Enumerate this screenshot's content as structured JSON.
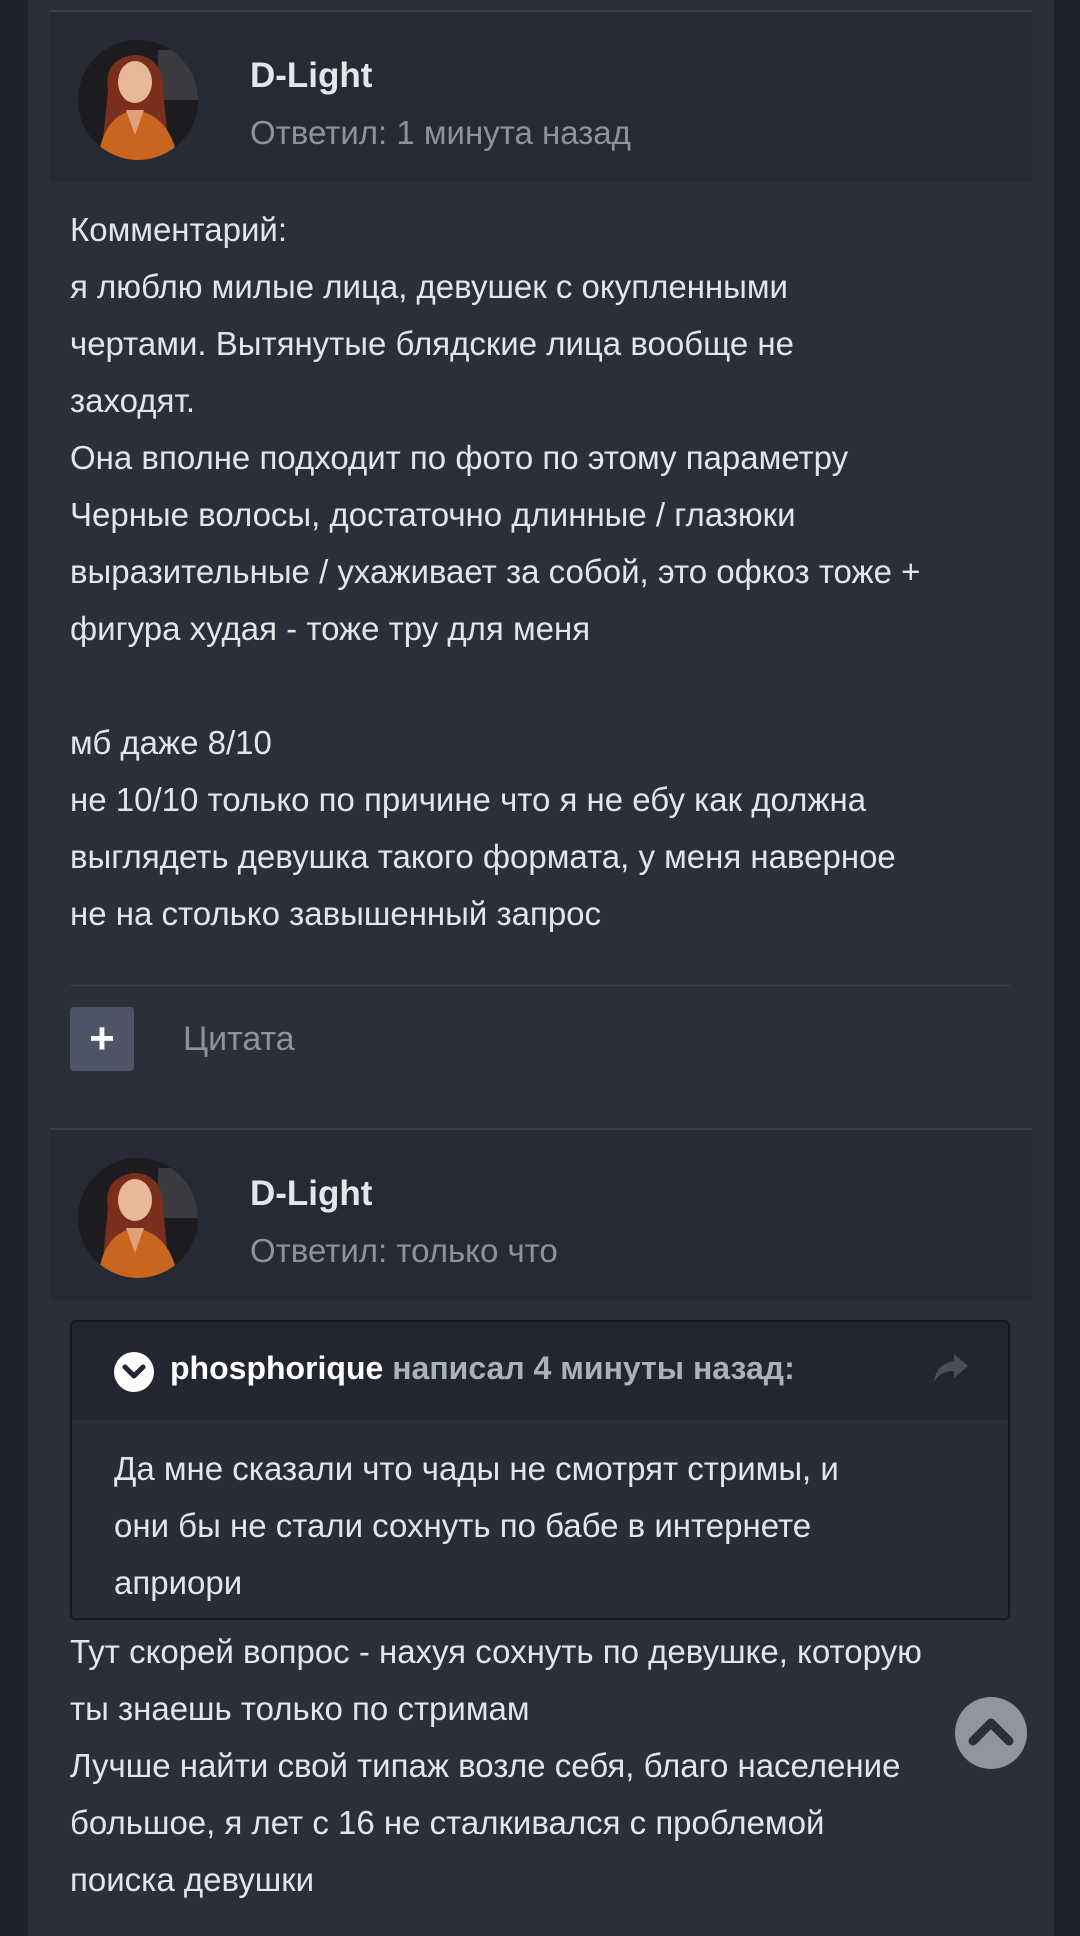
{
  "posts": [
    {
      "author": "D-Light",
      "meta": "Ответил: 1 минута назад",
      "lines": [
        "Комментарий:",
        "я люблю милые лица, девушек с окупленными",
        "чертами. Вытянутые блядские лица вообще не",
        "заходят.",
        "Она вполне подходит по фото по этому параметру",
        "Черные волосы, достаточно длинные / глазюки",
        "выразительные / ухаживает за собой, это офкоз тоже +",
        "фигура худая - тоже тру для меня",
        "",
        "мб даже 8/10",
        "не 10/10 только по причине что я не ебу как должна",
        "выглядеть девушка такого формата, у меня наверное",
        "не на столько завышенный запрос"
      ],
      "plus_label": "+",
      "quote_label": "Цитата"
    },
    {
      "author": "D-Light",
      "meta": "Ответил: только что",
      "quote": {
        "user": "phosphorique",
        "suffix": " написал 4 минуты назад:",
        "lines": [
          "Да мне сказали что чады не смотрят стримы, и",
          "они бы не стали сохнуть по бабе в интернете",
          "априори"
        ]
      },
      "lines": [
        "Тут скорей вопрос - нахуя сохнуть по девушке, которую",
        "ты знаешь только по стримам",
        "Лучше найти свой типаж возле себя, благо население",
        "большое, я лет с 16 не сталкивался с проблемой",
        "поиска девушки"
      ]
    }
  ],
  "icons": {
    "quote_toggle": "chevron-down-icon",
    "share": "share-icon",
    "scroll_top": "chevron-up-icon"
  }
}
